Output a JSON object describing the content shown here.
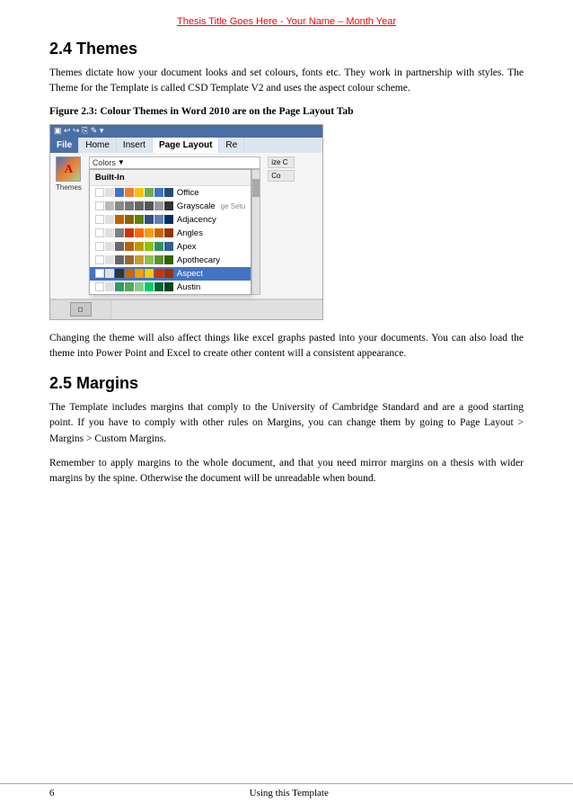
{
  "header": {
    "title": "Thesis Title Goes Here - Your Name – Month Year"
  },
  "section_24": {
    "heading": "2.4 Themes",
    "para1": "Themes dictate how your document looks and set colours, fonts etc. They work in partnership with styles.  The Theme for the Template is called CSD Template V2 and uses the aspect colour scheme.",
    "figure_caption": "Figure 2.3: Colour Themes in Word 2010 are on the Page Layout Tab",
    "para2": "Changing the theme will also affect things like excel graphs pasted into your documents. You can also load the theme into Power Point and Excel to create other content will a consistent appearance."
  },
  "section_25": {
    "heading": "2.5 Margins",
    "para1": "The Template includes margins that comply to the University of Cambridge Standard and are a good starting point.  If you have to comply with other rules on Margins, you can change them by going to Page Layout > Margins > Custom Margins.",
    "para2": "Remember to apply margins to the whole document, and that you need mirror margins on a thesis with wider margins by the spine. Otherwise the document will be unreadable when bound."
  },
  "word_ui": {
    "ribbon_tabs": [
      "File",
      "Home",
      "Insert",
      "Page Layout",
      "Re"
    ],
    "active_tab": "Page Layout",
    "colors_label": "Colors",
    "built_in_label": "Built-In",
    "themes_label": "Themes",
    "color_themes": [
      {
        "name": "Office",
        "swatches": [
          "#FFFFFF",
          "#d0d0d0",
          "#4472c4",
          "#ed7d31",
          "#ffc000",
          "#5baa56",
          "#4472c4",
          "#1f4e79"
        ]
      },
      {
        "name": "Grayscale",
        "swatches": [
          "#FFFFFF",
          "#d0d0d0",
          "#888",
          "#666",
          "#444",
          "#222",
          "#999",
          "#333"
        ]
      },
      {
        "name": "Adjacency",
        "swatches": [
          "#FFFFFF",
          "#e0e0e0",
          "#cc6600",
          "#996600",
          "#669900",
          "#336699",
          "#6699cc",
          "#003366"
        ]
      },
      {
        "name": "Angles",
        "swatches": [
          "#FFFFFF",
          "#d0d0d0",
          "#7f7f7f",
          "#cc3300",
          "#ff6600",
          "#ff9900",
          "#993300",
          "#330000"
        ]
      },
      {
        "name": "Apex",
        "swatches": [
          "#FFFFFF",
          "#e0e0e0",
          "#696969",
          "#cc6600",
          "#cc9900",
          "#99cc00",
          "#339966",
          "#336699"
        ]
      },
      {
        "name": "Apothecary",
        "swatches": [
          "#FFFFFF",
          "#e0e0e0",
          "#666",
          "#996633",
          "#cc9933",
          "#99cc66",
          "#669933",
          "#336600"
        ]
      },
      {
        "name": "Aspect",
        "swatches": [
          "#FFFFFF",
          "#e0e0e0",
          "#333",
          "#cc6600",
          "#ff9900",
          "#ffcc00",
          "#cc3300",
          "#993300"
        ]
      },
      {
        "name": "Austin",
        "swatches": [
          "#FFFFFF",
          "#e0e0e0",
          "#339966",
          "#66cc66",
          "#99ff99",
          "#00cc66",
          "#006633",
          "#003300"
        ]
      }
    ]
  },
  "footer": {
    "page_number": "6",
    "center_text": "Using this Template"
  }
}
